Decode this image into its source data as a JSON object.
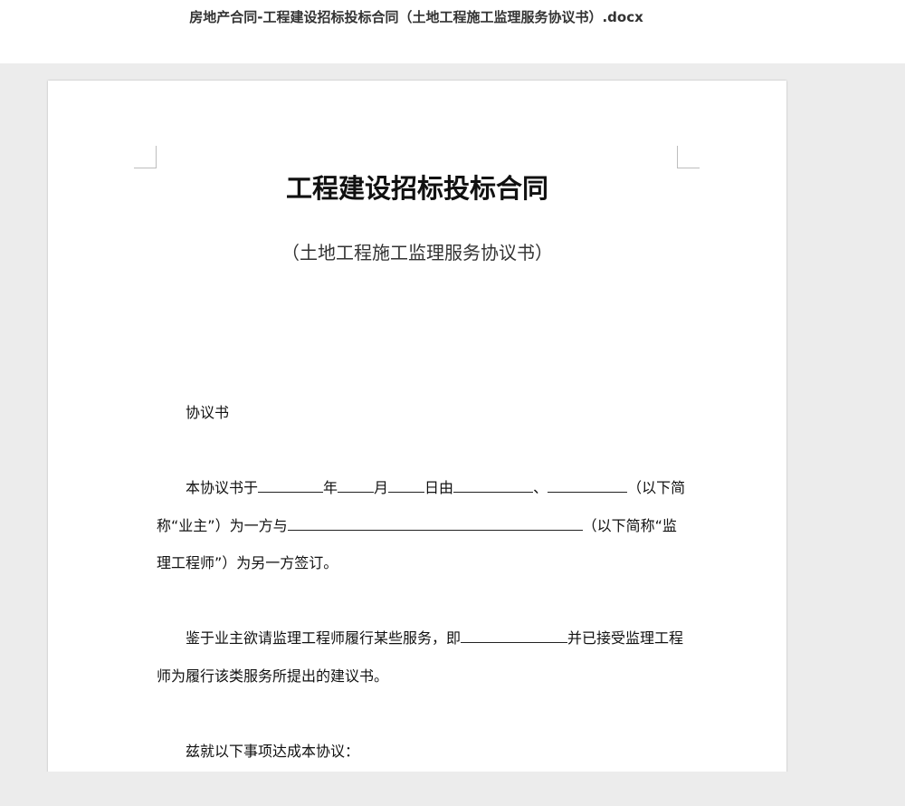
{
  "window": {
    "title": "房地产合同-工程建设招标投标合同（土地工程施工监理服务协议书）.docx"
  },
  "document": {
    "heading": "工程建设招标投标合同",
    "subheading": "（土地工程施工监理服务协议书）",
    "section_label": "协议书",
    "para1": {
      "t1": "本协议书于",
      "t2": "年",
      "t3": "月",
      "t4": "日由",
      "t5": "、",
      "t6": "（以下简",
      "line2_start": "称“业主”）为一方与",
      "line2_end": "（以下简称“监",
      "line3": "理工程师”）为另一方签订。"
    },
    "para2": {
      "t1": "鉴于业主欲请监理工程师履行某些服务，即",
      "t2": "并已接受监理工程",
      "line2": "师为履行该类服务所提出的建议书。"
    },
    "para3": "兹就以下事项达成本协议："
  }
}
